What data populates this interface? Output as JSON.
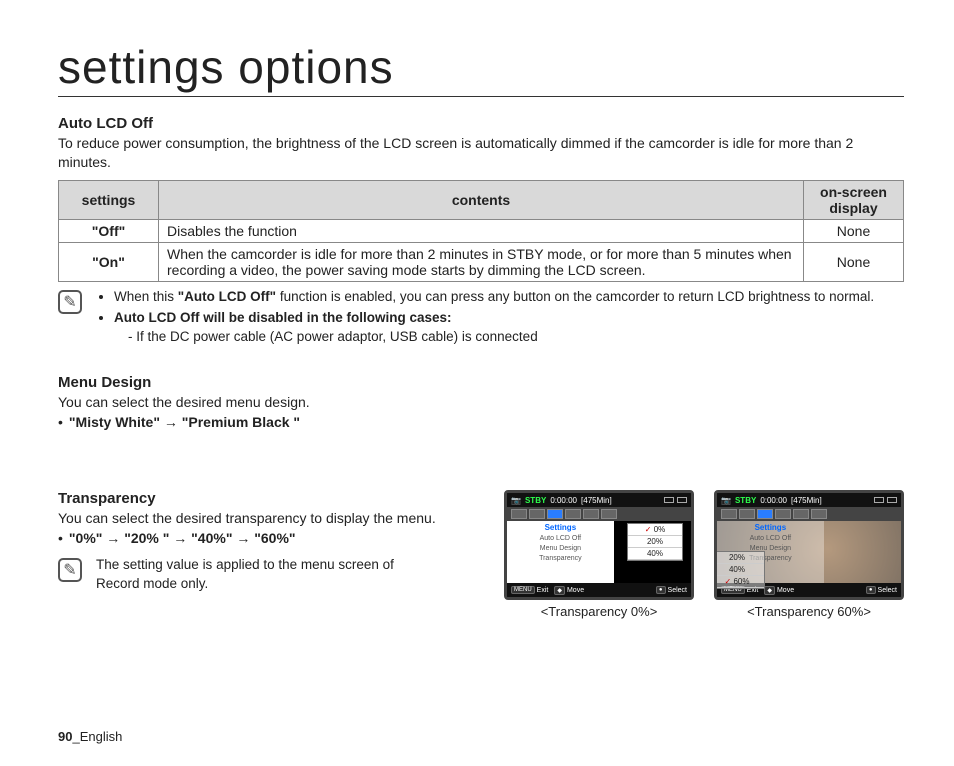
{
  "pageTitle": "settings options",
  "autoLcd": {
    "heading": "Auto LCD Off",
    "intro": "To reduce power consumption, the brightness of the LCD screen is automatically dimmed if the camcorder is idle for more than 2 minutes.",
    "table": {
      "headers": {
        "c1": "settings",
        "c2": "contents",
        "c3": "on-screen display"
      },
      "rows": [
        {
          "setting": "\"Off\"",
          "content": "Disables the function",
          "osd": "None"
        },
        {
          "setting": "\"On\"",
          "content": "When the camcorder is idle for more than 2 minutes in STBY mode, or for more than 5 minutes when recording a video, the power saving mode starts by dimming the LCD screen.",
          "osd": "None"
        }
      ]
    },
    "note": {
      "line1a": "When this ",
      "line1bold": "\"Auto LCD Off\"",
      "line1b": " function is enabled, you can press any button on the camcorder to return LCD brightness to normal.",
      "line2bold": "Auto LCD Off will be disabled in the following cases:",
      "line2sub": "-  If the DC power cable (AC power adaptor, USB cable) is connected"
    }
  },
  "menuDesign": {
    "heading": "Menu Design",
    "intro": "You can select the desired menu design.",
    "options": "\"Misty White\" → \"Premium Black \""
  },
  "transparency": {
    "heading": "Transparency",
    "intro": "You can select the desired transparency to display the menu.",
    "options": "\"0%\" → \"20% \" → \"40%\" → \"60%\"",
    "note": "The setting value is applied to the menu screen of Record mode only."
  },
  "screenshots": {
    "left": {
      "stby": "STBY",
      "time": "0:00:00",
      "remain": "[475Min]",
      "settingsLabel": "Settings",
      "items": [
        "Auto LCD Off",
        "Menu Design",
        "Transparency"
      ],
      "popup": [
        "0%",
        "20%",
        "40%"
      ],
      "bottom": {
        "exit": "Exit",
        "move": "Move",
        "select": "Select",
        "menuKey": "MENU"
      },
      "caption": "<Transparency 0%>"
    },
    "right": {
      "stby": "STBY",
      "time": "0:00:00",
      "remain": "[475Min]",
      "settingsLabel": "Settings",
      "items": [
        "Auto LCD Off",
        "Menu Design",
        "Transparency"
      ],
      "popup": [
        "20%",
        "40%",
        "60%"
      ],
      "bottom": {
        "exit": "Exit",
        "move": "Move",
        "select": "Select",
        "menuKey": "MENU"
      },
      "caption": "<Transparency 60%>"
    }
  },
  "footer": {
    "page": "90",
    "sep": "_",
    "lang": "English"
  }
}
